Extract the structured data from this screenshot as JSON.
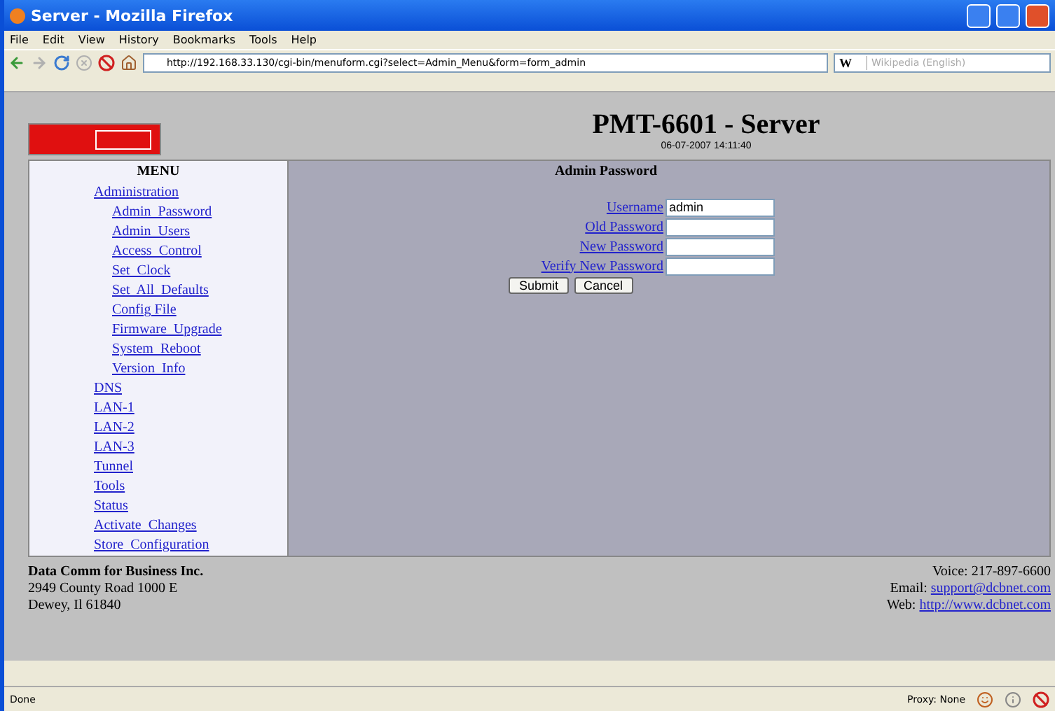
{
  "window": {
    "title": "Server - Mozilla Firefox"
  },
  "menu_bar": [
    "File",
    "Edit",
    "View",
    "History",
    "Bookmarks",
    "Tools",
    "Help"
  ],
  "address_bar": {
    "value": "http://192.168.33.130/cgi-bin/menuform.cgi?select=Admin_Menu&form=form_admin"
  },
  "search_field": {
    "placeholder": "Wikipedia (English)"
  },
  "search_engine": "W",
  "page": {
    "title": "PMT-6601 - Server",
    "datetime": "06-07-2007 14:11:40",
    "menu": {
      "heading": "MENU",
      "items": [
        {
          "label": "Administration",
          "children": [
            {
              "label": "Admin  Password"
            },
            {
              "label": "Admin  Users"
            },
            {
              "label": "Access  Control"
            },
            {
              "label": "Set  Clock"
            },
            {
              "label": "Set  All  Defaults"
            },
            {
              "label": "Config File"
            },
            {
              "label": "Firmware  Upgrade"
            },
            {
              "label": "System  Reboot"
            },
            {
              "label": "Version  Info"
            }
          ]
        },
        {
          "label": "DNS"
        },
        {
          "label": "LAN-1"
        },
        {
          "label": "LAN-2"
        },
        {
          "label": "LAN-3"
        },
        {
          "label": "Tunnel"
        },
        {
          "label": "Tools"
        },
        {
          "label": "Status"
        },
        {
          "label": "Activate  Changes"
        },
        {
          "label": "Store  Configuration"
        }
      ]
    },
    "form": {
      "heading": "Admin Password",
      "fields": [
        {
          "label": "Username",
          "value": "admin"
        },
        {
          "label": "Old Password"
        },
        {
          "label": "New Password"
        },
        {
          "label": "Verify New Password"
        }
      ],
      "buttons": [
        "Submit",
        "Cancel"
      ]
    },
    "footer": {
      "company": "Data Comm for Business Inc.",
      "address": [
        "2949 County Road 1000 E",
        "Dewey, Il 61840"
      ],
      "voice": "Voice: 217-897-6600",
      "email_label": "Email:",
      "email": "support@dcbnet.com",
      "web_label": "Web:",
      "web": "http://www.dcbnet.com"
    }
  },
  "status_bar": {
    "text": "Done",
    "proxy": "Proxy: None"
  }
}
